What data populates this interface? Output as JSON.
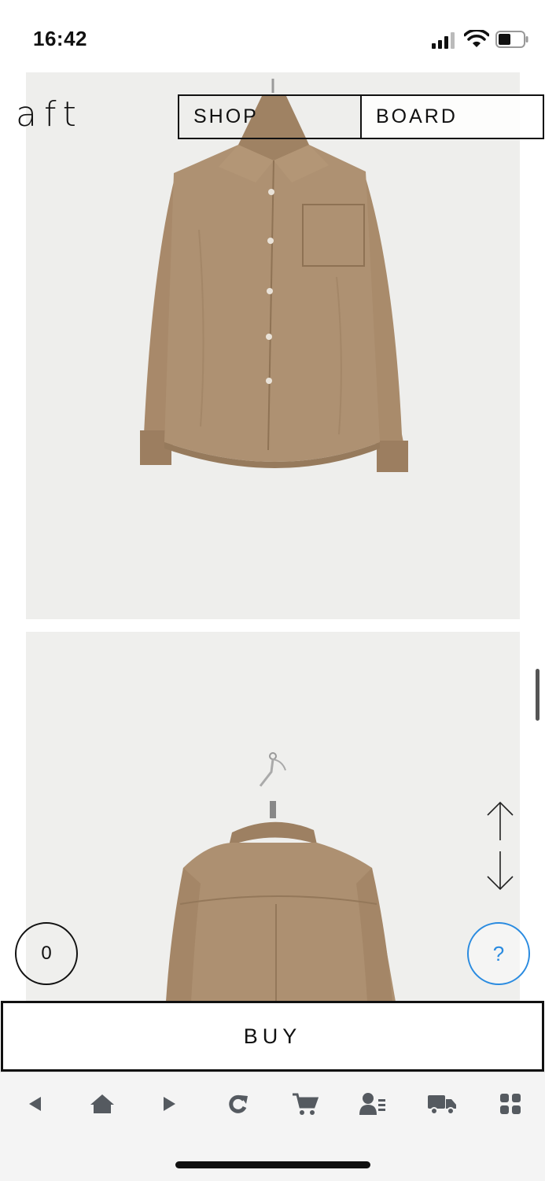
{
  "status_bar": {
    "time": "16:42",
    "icons": [
      "cellular-signal-icon",
      "wifi-icon",
      "battery-icon"
    ]
  },
  "header": {
    "logo": "aft",
    "nav": [
      {
        "label": "SHOP"
      },
      {
        "label": "BOARD"
      }
    ]
  },
  "product_images": [
    {
      "subject": "beige button-up shirt, front view"
    },
    {
      "subject": "beige button-up shirt, back view"
    }
  ],
  "floating": {
    "cart_count": "0",
    "help_label": "?",
    "scroll_up_icon": "arrow-up-icon",
    "scroll_down_icon": "arrow-down-icon"
  },
  "buy_button": {
    "label": "BUY"
  },
  "toolbar": {
    "items": [
      "back-icon",
      "home-icon",
      "forward-icon",
      "refresh-icon",
      "cart-icon",
      "my-page-icon",
      "delivery-icon",
      "menu-grid-icon"
    ]
  },
  "colors": {
    "help_accent": "#2a8be0",
    "shirt": "#a98d6c",
    "toolbar_bg": "#f4f4f4",
    "toolbar_icon": "#555a60"
  }
}
